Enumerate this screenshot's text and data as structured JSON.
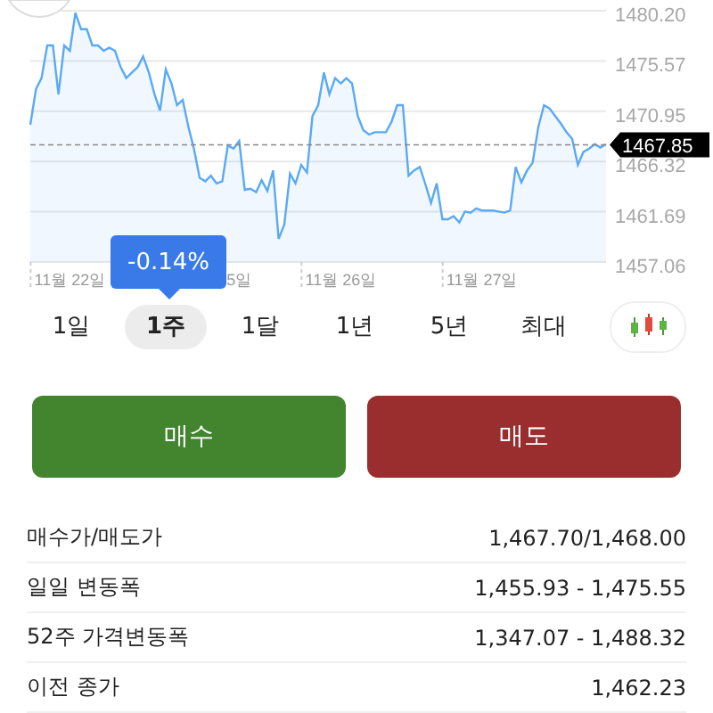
{
  "chart": {
    "tooltip": "-0.14%",
    "chart_data": {
      "type": "area",
      "ylim": [
        1457.06,
        1480.2
      ],
      "grid": true,
      "ref_lines": [
        {
          "axis": "y",
          "value": 1467.85,
          "label": "1467.85"
        }
      ],
      "categories": [
        null,
        null,
        null,
        null,
        null,
        null,
        null,
        "11월 22일",
        null,
        null,
        null,
        null,
        null,
        null,
        null,
        null,
        null,
        null,
        null,
        null,
        null,
        null,
        null,
        null,
        null,
        null,
        null,
        null,
        null,
        null,
        null,
        null,
        null,
        null,
        null,
        null,
        null,
        "5일",
        null,
        null,
        null,
        null,
        null,
        null,
        null,
        null,
        null,
        null,
        null,
        null,
        null,
        null,
        null,
        null,
        null,
        "11월 26일",
        null,
        null,
        null,
        null,
        null,
        null,
        null,
        null,
        null,
        null,
        null,
        null,
        null,
        null,
        null,
        null,
        null,
        null,
        null,
        null,
        null,
        null,
        null,
        null,
        "11월 27일",
        null,
        null,
        null,
        null,
        null,
        null,
        null,
        null,
        null,
        null,
        null,
        null,
        null,
        null,
        null,
        null,
        null,
        null,
        null,
        null,
        null,
        null
      ],
      "yticks": [
        {
          "value": 1480.2,
          "label": "1480.20"
        },
        {
          "value": 1475.57,
          "label": "1475.57"
        },
        {
          "value": 1470.95,
          "label": "1470.95"
        },
        {
          "value": 1466.32,
          "label": "1466.32"
        },
        {
          "value": 1461.69,
          "label": "1461.69"
        },
        {
          "value": 1457.06,
          "label": "1457.06"
        }
      ],
      "series": [
        {
          "color": "#5aa9f5",
          "values": [
            1469.7,
            1473,
            1474,
            1477,
            1477,
            1472.5,
            1477,
            1476.5,
            1480,
            1478.5,
            1478.5,
            1477,
            1477,
            1476.5,
            1476.8,
            1476.5,
            1475,
            1474,
            1474.5,
            1475,
            1476,
            1474.5,
            1472.5,
            1471,
            1474.8,
            1473.5,
            1471.5,
            1472,
            1469.5,
            1467.5,
            1464.8,
            1464.5,
            1465,
            1464.3,
            1464.5,
            1467.8,
            1467.5,
            1468.2,
            1463.7,
            1463.8,
            1463.5,
            1464.6,
            1463.6,
            1465.5,
            1459.2,
            1460.5,
            1465.2,
            1464.3,
            1466,
            1465.3,
            1470.5,
            1471.5,
            1474.5,
            1472.5,
            1474,
            1473.5,
            1474,
            1473.5,
            1470.5,
            1469.2,
            1468.8,
            1469,
            1469,
            1469,
            1470,
            1471.5,
            1471.5,
            1465,
            1465.5,
            1465.8,
            1464.2,
            1462.5,
            1464.3,
            1461,
            1461,
            1461.3,
            1460.7,
            1461.7,
            1461.6,
            1462,
            1461.8,
            1461.8,
            1461.8,
            1461.7,
            1461.6,
            1461.8,
            1465.8,
            1464.4,
            1465.5,
            1466.2,
            1469.5,
            1471.5,
            1471.2,
            1470.5,
            1469.8,
            1469,
            1468.4,
            1466,
            1467.2,
            1467.5,
            1467.9,
            1467.6,
            1467.9
          ]
        }
      ]
    }
  },
  "periods": [
    {
      "label": "1일",
      "selected": false
    },
    {
      "label": "1주",
      "selected": true
    },
    {
      "label": "1달",
      "selected": false
    },
    {
      "label": "1년",
      "selected": false
    },
    {
      "label": "5년",
      "selected": false
    },
    {
      "label": "최대",
      "selected": false
    }
  ],
  "actions": [
    {
      "label": "매수",
      "kind": "buy"
    },
    {
      "label": "매도",
      "kind": "sell"
    }
  ],
  "stats": [
    {
      "label": "매수가/매도가",
      "value": "1,467.70/1,468.00"
    },
    {
      "label": "일일 변동폭",
      "value": "1,455.93 - 1,475.55"
    },
    {
      "label": "52주 가격변동폭",
      "value": "1,347.07 - 1,488.32"
    },
    {
      "label": "이전 종가",
      "value": "1,462.23"
    }
  ]
}
